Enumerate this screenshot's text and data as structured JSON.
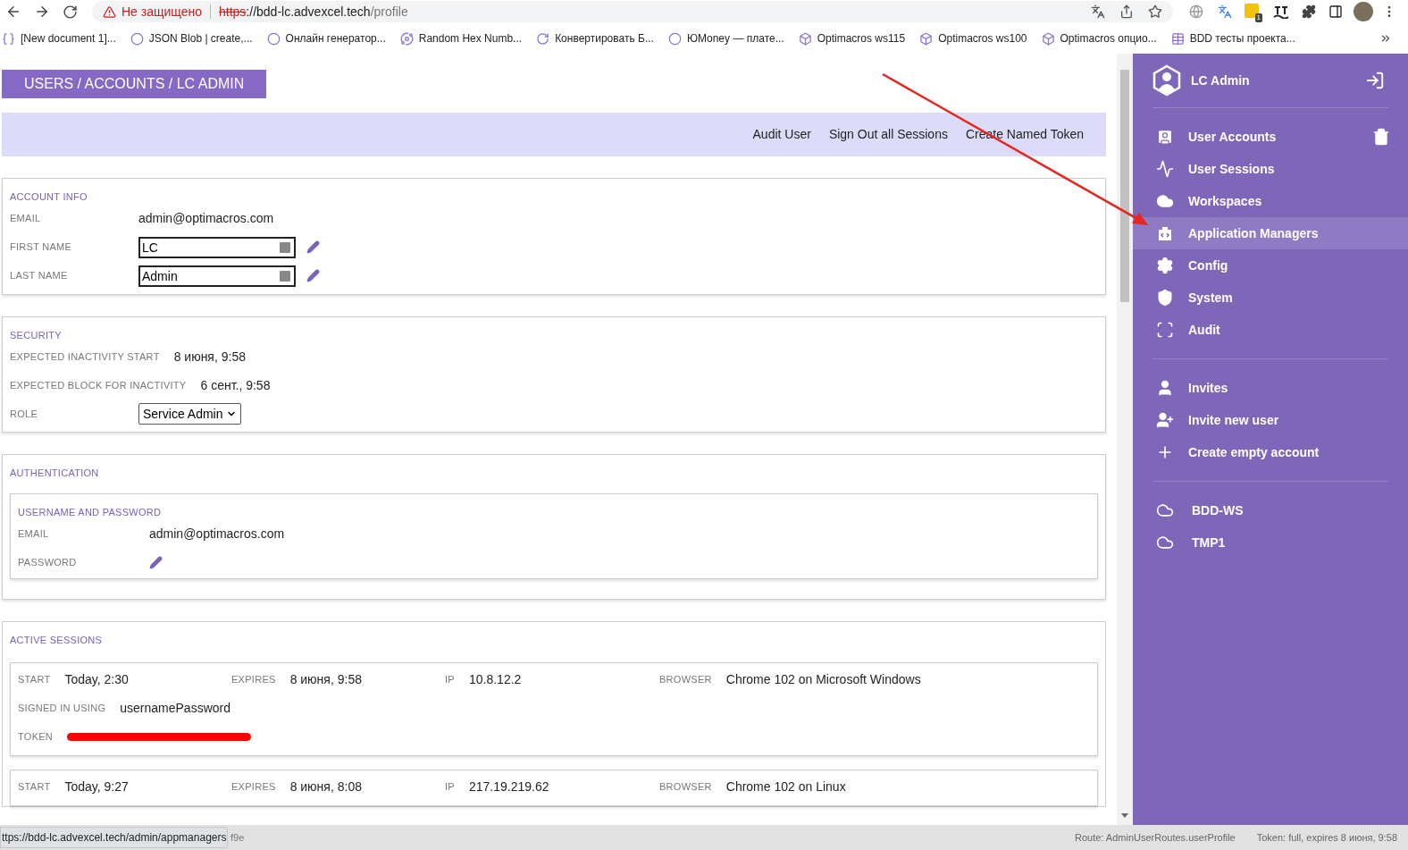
{
  "browser": {
    "security_label": "Не защищено",
    "url_scheme": "https",
    "url_host": "://bdd-lc.advexcel.tech",
    "url_path": "/profile",
    "bookmarks": [
      "[New document 1]...",
      "JSON Blob | create,...",
      "Онлайн генератор...",
      "Random Hex Numb...",
      "Конвертировать Б...",
      "ЮMoney — плате...",
      "Optimacros ws115",
      "Optimacros ws100",
      "Optimacros опцио...",
      "BDD тесты проекта..."
    ],
    "extension_badge": "1"
  },
  "breadcrumb": "USERS / ACCOUNTS / LC ADMIN",
  "actions": [
    "Audit User",
    "Sign Out all Sessions",
    "Create Named Token"
  ],
  "account_info": {
    "title": "ACCOUNT INFO",
    "email_label": "EMAIL",
    "email": "admin@optimacros.com",
    "fields": [
      {
        "label": "FIRST NAME",
        "value": "LC"
      },
      {
        "label": "LAST NAME",
        "value": "Admin"
      }
    ]
  },
  "security": {
    "title": "SECURITY",
    "rows": [
      {
        "label": "EXPECTED INACTIVITY START",
        "value": "8 июня, 9:58"
      },
      {
        "label": "EXPECTED BLOCK FOR INACTIVITY",
        "value": "6 сент., 9:58"
      }
    ],
    "role_label": "ROLE",
    "role": "Service Admin"
  },
  "authentication": {
    "title": "AUTHENTICATION",
    "subtitle": "USERNAME AND PASSWORD",
    "email_label": "EMAIL",
    "email": "admin@optimacros.com",
    "password_label": "PASSWORD"
  },
  "active_sessions": {
    "title": "ACTIVE SESSIONS",
    "sessions": [
      {
        "labels": {
          "start": "START",
          "expires": "EXPIRES",
          "ip": "IP",
          "browser": "BROWSER",
          "signed_in": "SIGNED IN USING",
          "token": "TOKEN"
        },
        "start": "Today, 2:30",
        "expires": "8 июня, 9:58",
        "ip": "10.8.12.2",
        "browser": "Chrome 102 on Microsoft Windows",
        "signed_in": "usernamePassword"
      },
      {
        "labels": {
          "start": "START",
          "expires": "EXPIRES",
          "ip": "IP",
          "browser": "BROWSER"
        },
        "start": "Today, 9:27",
        "expires": "8 июня, 8:08",
        "ip": "217.19.219.62",
        "browser": "Chrome 102 on Linux"
      }
    ]
  },
  "sidebar": {
    "user": "LC Admin",
    "groups": [
      {
        "items": [
          {
            "label": "User Accounts",
            "selected": false
          },
          {
            "label": "User Sessions",
            "selected": false
          },
          {
            "label": "Workspaces",
            "selected": false
          },
          {
            "label": "Application Managers",
            "selected": true
          },
          {
            "label": "Config",
            "selected": false
          },
          {
            "label": "System",
            "selected": false
          },
          {
            "label": "Audit",
            "selected": false
          }
        ]
      },
      {
        "items": [
          {
            "label": "Invites",
            "selected": false
          },
          {
            "label": "Invite new user",
            "selected": false
          },
          {
            "label": "Create empty account",
            "selected": false
          }
        ]
      },
      {
        "items": [
          {
            "label": "BDD-WS",
            "selected": false
          },
          {
            "label": "TMP1",
            "selected": false
          }
        ]
      }
    ]
  },
  "status_bar": {
    "link_preview": "ttps://bdd-lc.advexcel.tech/admin/appmanagers",
    "hidden_fragment": "f9e",
    "route": "Route: AdminUserRoutes.userProfile",
    "token": "Token: full, expires 8 июня, 9:58"
  }
}
